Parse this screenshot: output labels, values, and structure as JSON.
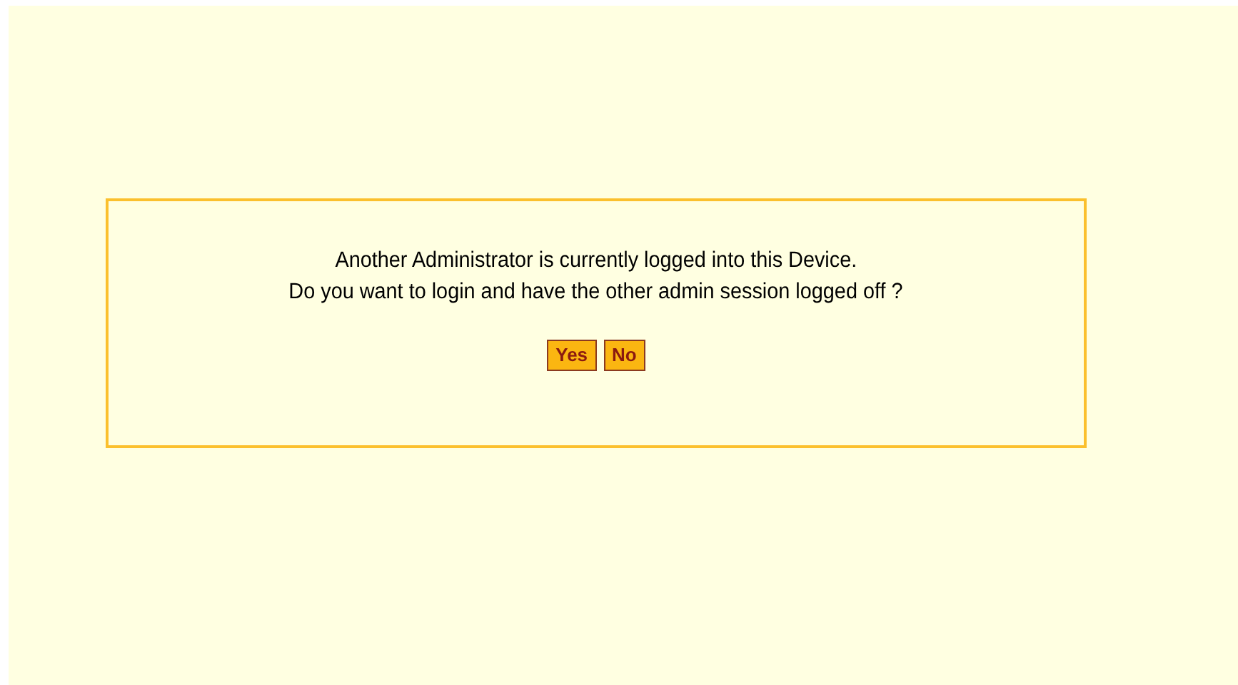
{
  "dialog": {
    "message_lines": [
      "Another Administrator is currently logged into this Device.",
      "Do you want to login and have the other admin session logged off ?"
    ],
    "buttons": [
      "Yes",
      "No"
    ]
  }
}
